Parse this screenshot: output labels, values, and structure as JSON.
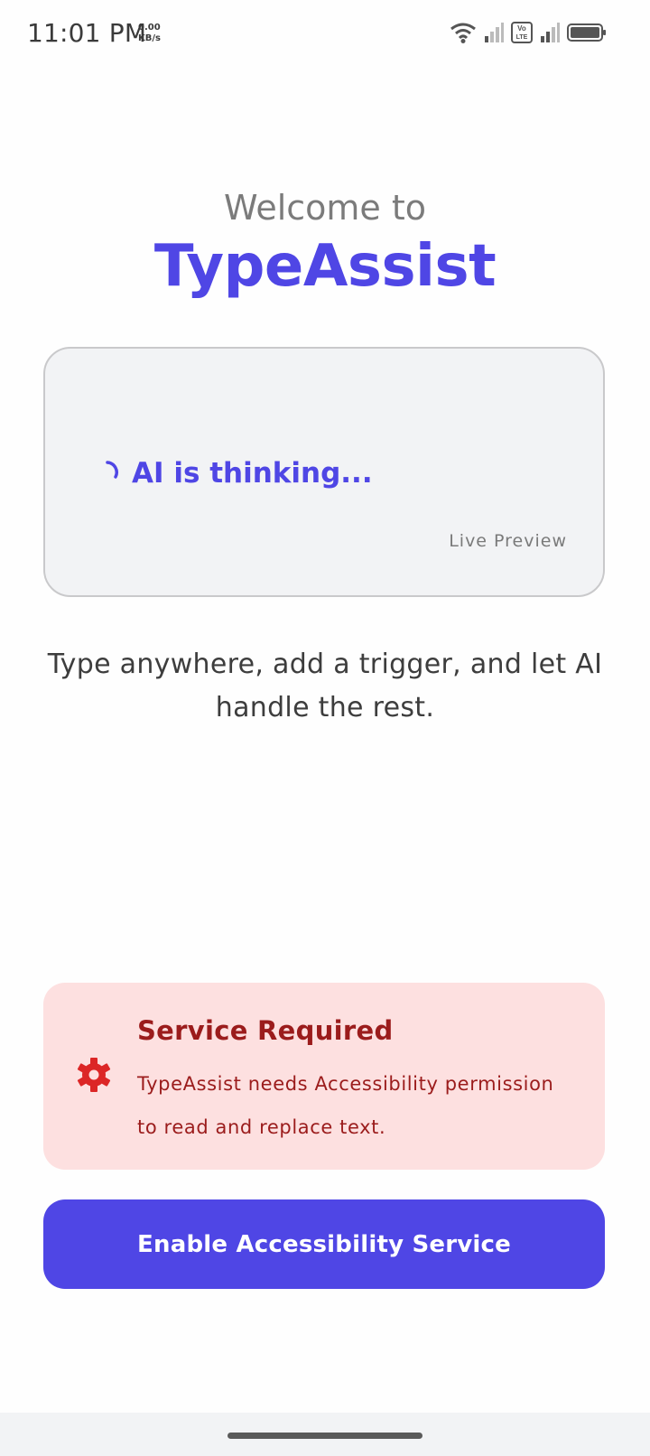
{
  "status_bar": {
    "time": "11:01 PM",
    "net_speed_value": "0.00",
    "net_speed_unit": "KB/s",
    "volte_label": "Vo LTE",
    "icons": [
      "wifi-icon",
      "signal-icon",
      "volte-icon",
      "signal-icon",
      "battery-icon"
    ]
  },
  "header": {
    "welcome": "Welcome to",
    "app_name": "TypeAssist"
  },
  "preview": {
    "status_text": "AI is thinking...",
    "caption": "Live Preview"
  },
  "tagline": "Type anywhere, add a trigger, and let AI handle the rest.",
  "alert": {
    "title": "Service Required",
    "message": "TypeAssist needs Accessibility permission to read and replace text.",
    "icon": "gear-icon"
  },
  "actions": {
    "enable_button": "Enable Accessibility Service"
  },
  "colors": {
    "accent": "#4f46e5",
    "alert_background": "#fde0e0",
    "alert_text": "#9b1c1c",
    "alert_icon": "#dc2626"
  }
}
